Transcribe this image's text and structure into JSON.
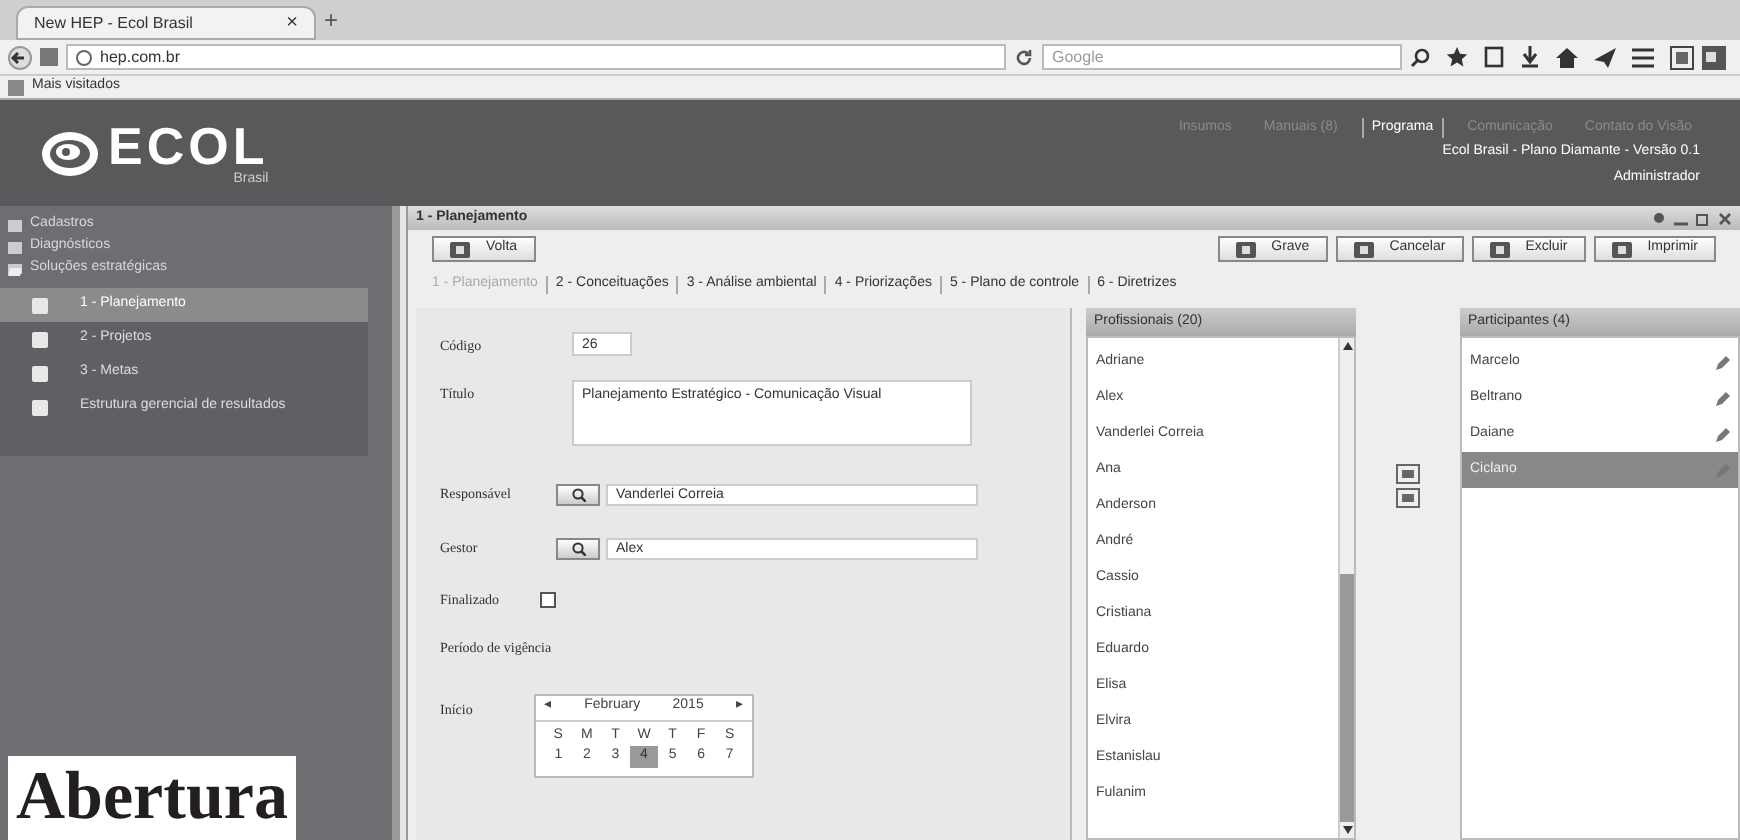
{
  "browser": {
    "tab_title": "New HEP - Ecol Brasil",
    "tab_close": "×",
    "new_tab": "+",
    "url": "hep.com.br",
    "search_placeholder": "Google",
    "bookmarks": "Mais visitados"
  },
  "header": {
    "logo": "ECOL",
    "logo_sub": "Brasil",
    "nav": [
      {
        "label": "Insumos",
        "selected": false
      },
      {
        "label": "Manuais (8)",
        "selected": false
      },
      {
        "label": "Programa",
        "selected": true
      },
      {
        "label": "Comunicação",
        "selected": false
      },
      {
        "label": "Contato do Visão",
        "selected": false
      }
    ],
    "info": "Ecol Brasil - Plano Diamante - Versão 0.1",
    "user": "Administrador"
  },
  "sidebar": {
    "items": [
      {
        "label": "Cadastros",
        "expanded": false
      },
      {
        "label": "Diagnósticos",
        "expanded": false
      },
      {
        "label": "Soluções estratégicas",
        "expanded": true,
        "children": [
          {
            "label": "1 - Planejamento",
            "selected": true
          },
          {
            "label": "2 - Projetos",
            "selected": false
          },
          {
            "label": "3 - Metas",
            "selected": false
          },
          {
            "label": "Estrutura gerencial de resultados",
            "selected": false
          }
        ]
      }
    ]
  },
  "panel": {
    "title": "1 - Planejamento",
    "back": "Volta",
    "actions": [
      "Grave",
      "Cancelar",
      "Excluir",
      "Imprimir"
    ],
    "tabs": [
      {
        "label": "1 - Planejamento",
        "selected": true
      },
      {
        "label": "2 - Conceituações",
        "selected": false
      },
      {
        "label": "3 - Análise ambiental",
        "selected": false
      },
      {
        "label": "4 - Priorizações",
        "selected": false
      },
      {
        "label": "5 - Plano de controle",
        "selected": false
      },
      {
        "label": "6 - Diretrizes",
        "selected": false
      }
    ],
    "form": {
      "code_label": "Código",
      "code": "26",
      "title_label": "Título",
      "title": "Planejamento Estratégico - Comunicação Visual",
      "responsible_label": "Responsável",
      "responsible": "Vanderlei Correia",
      "manager_label": "Gestor",
      "manager": "Alex",
      "finished_label": "Finalizado",
      "finished": false,
      "period_label": "Período de vigência",
      "start_label": "Início",
      "calendar": {
        "prev": "◂",
        "month": "February",
        "year": "2015",
        "next": "▸",
        "weekdays": [
          "S",
          "M",
          "T",
          "W",
          "T",
          "F",
          "S"
        ],
        "days": [
          {
            "label": "1",
            "selected": false
          },
          {
            "label": "2",
            "selected": false
          },
          {
            "label": "3",
            "selected": false
          },
          {
            "label": "4",
            "selected": true
          },
          {
            "label": "5",
            "selected": false
          },
          {
            "label": "6",
            "selected": false
          },
          {
            "label": "7",
            "selected": false
          }
        ]
      }
    },
    "professionals": {
      "title": "Profissionais (20)",
      "items": [
        "Adriane",
        "Alex",
        "Vanderlei Correia",
        "Ana",
        "Anderson",
        "André",
        "Cassio",
        "Cristiana",
        "Eduardo",
        "Elisa",
        "Elvira",
        "Estanislau",
        "Fulanim"
      ]
    },
    "participants": {
      "title": "Participantes (4)",
      "items": [
        {
          "label": "Marcelo",
          "selected": false
        },
        {
          "label": "Beltrano",
          "selected": false
        },
        {
          "label": "Daiane",
          "selected": false
        },
        {
          "label": "Ciclano",
          "selected": true
        }
      ]
    }
  },
  "caption": "Abertura"
}
